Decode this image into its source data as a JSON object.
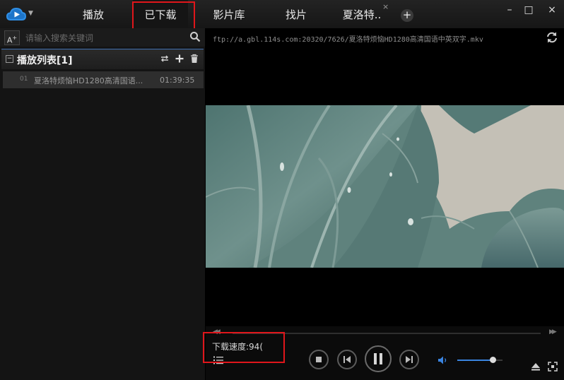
{
  "tabs": [
    {
      "label": "播放",
      "active": false
    },
    {
      "label": "已下载",
      "active": true
    },
    {
      "label": "影片库",
      "active": false
    },
    {
      "label": "找片",
      "active": false
    },
    {
      "label": "夏洛特..",
      "active": false
    }
  ],
  "tab_close_glyph": "×",
  "tab_add_glyph": "+",
  "window_buttons": {
    "minimize": "–",
    "maximize": "□",
    "close": "×"
  },
  "sidebar": {
    "font_button_label": "A",
    "font_button_sup": "+",
    "search_placeholder": "请输入搜索关键词",
    "playlist_title": "播放列表[1]",
    "collapse_glyph": "−",
    "items": [
      {
        "index": "01",
        "name": "夏洛特烦恼HD1280高清国语...",
        "duration": "01:39:35"
      }
    ]
  },
  "player": {
    "url": "ftp://a.gbl.114s.com:20320/7626/夏洛特烦恼HD1280高清国语中英双字.mkv"
  },
  "controls": {
    "seek_back_glyph": "◀◀",
    "seek_forward_glyph": "▶▶",
    "seek_progress": 0.0,
    "download_speed_label": "下载速度:94(",
    "volume": 0.78
  },
  "icons": {
    "logo": "cloud-play-logo-icon",
    "search": "search-icon",
    "loop": "loop-icon",
    "add": "add-icon",
    "delete": "trash-icon",
    "refresh": "refresh-icon",
    "list": "list-icon",
    "stop": "stop-icon",
    "previous": "previous-icon",
    "pause": "pause-icon",
    "next": "next-icon",
    "volume": "volume-icon",
    "eject": "eject-icon",
    "fullscreen": "fullscreen-icon"
  },
  "colors": {
    "accent_blue": "#3a84e0",
    "highlight_red": "#e0161b",
    "background": "#000000"
  }
}
